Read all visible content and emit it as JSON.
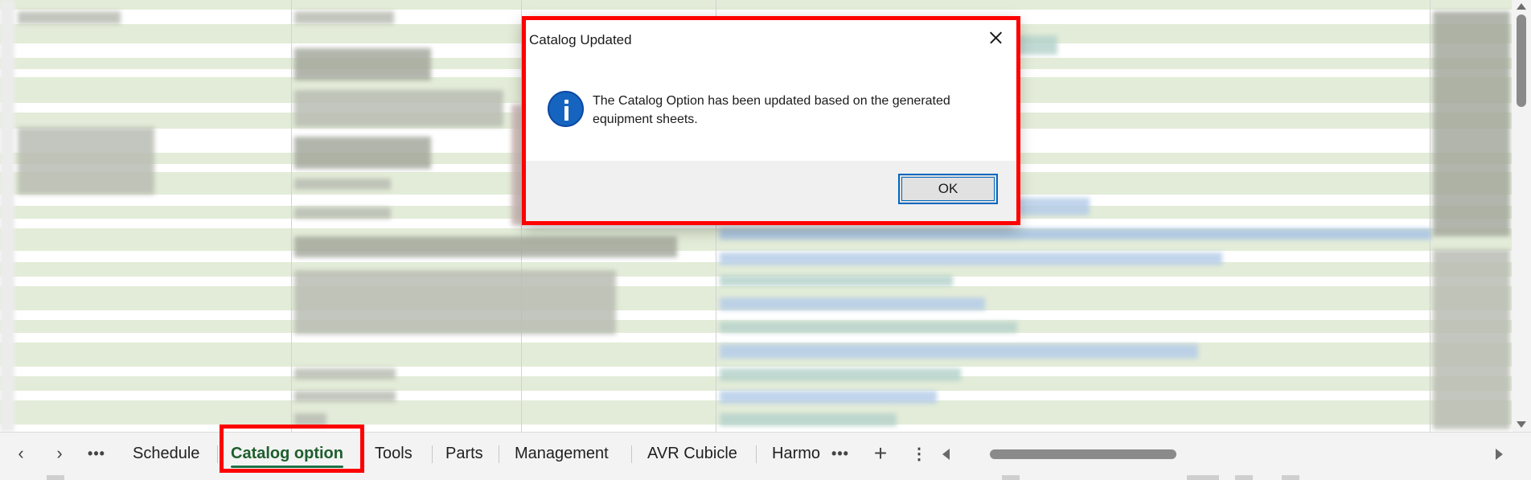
{
  "dialog": {
    "title": "Catalog Updated",
    "icon": "info-icon",
    "message": "The Catalog Option has been updated based on the generated equipment sheets.",
    "ok_label": "OK",
    "close_icon": "close-icon"
  },
  "sheet_tabs": {
    "prev_icon": "‹",
    "next_icon": "›",
    "more_icon": "•••",
    "tabs": [
      {
        "label": "Schedule",
        "active": false
      },
      {
        "label": "Catalog option",
        "active": true
      },
      {
        "label": "Tools",
        "active": false
      },
      {
        "label": "Parts",
        "active": false
      },
      {
        "label": "Management",
        "active": false
      },
      {
        "label": "AVR Cubicle",
        "active": false
      },
      {
        "label": "Harmo",
        "active": false
      }
    ],
    "overflow_icon": "•••",
    "add_icon": "+",
    "options_icon": "⋮"
  },
  "colors": {
    "highlight": "#ff0000",
    "active_tab": "#1e7145",
    "info_icon": "#1565c0",
    "row_band_green": "#e3ecd8"
  }
}
